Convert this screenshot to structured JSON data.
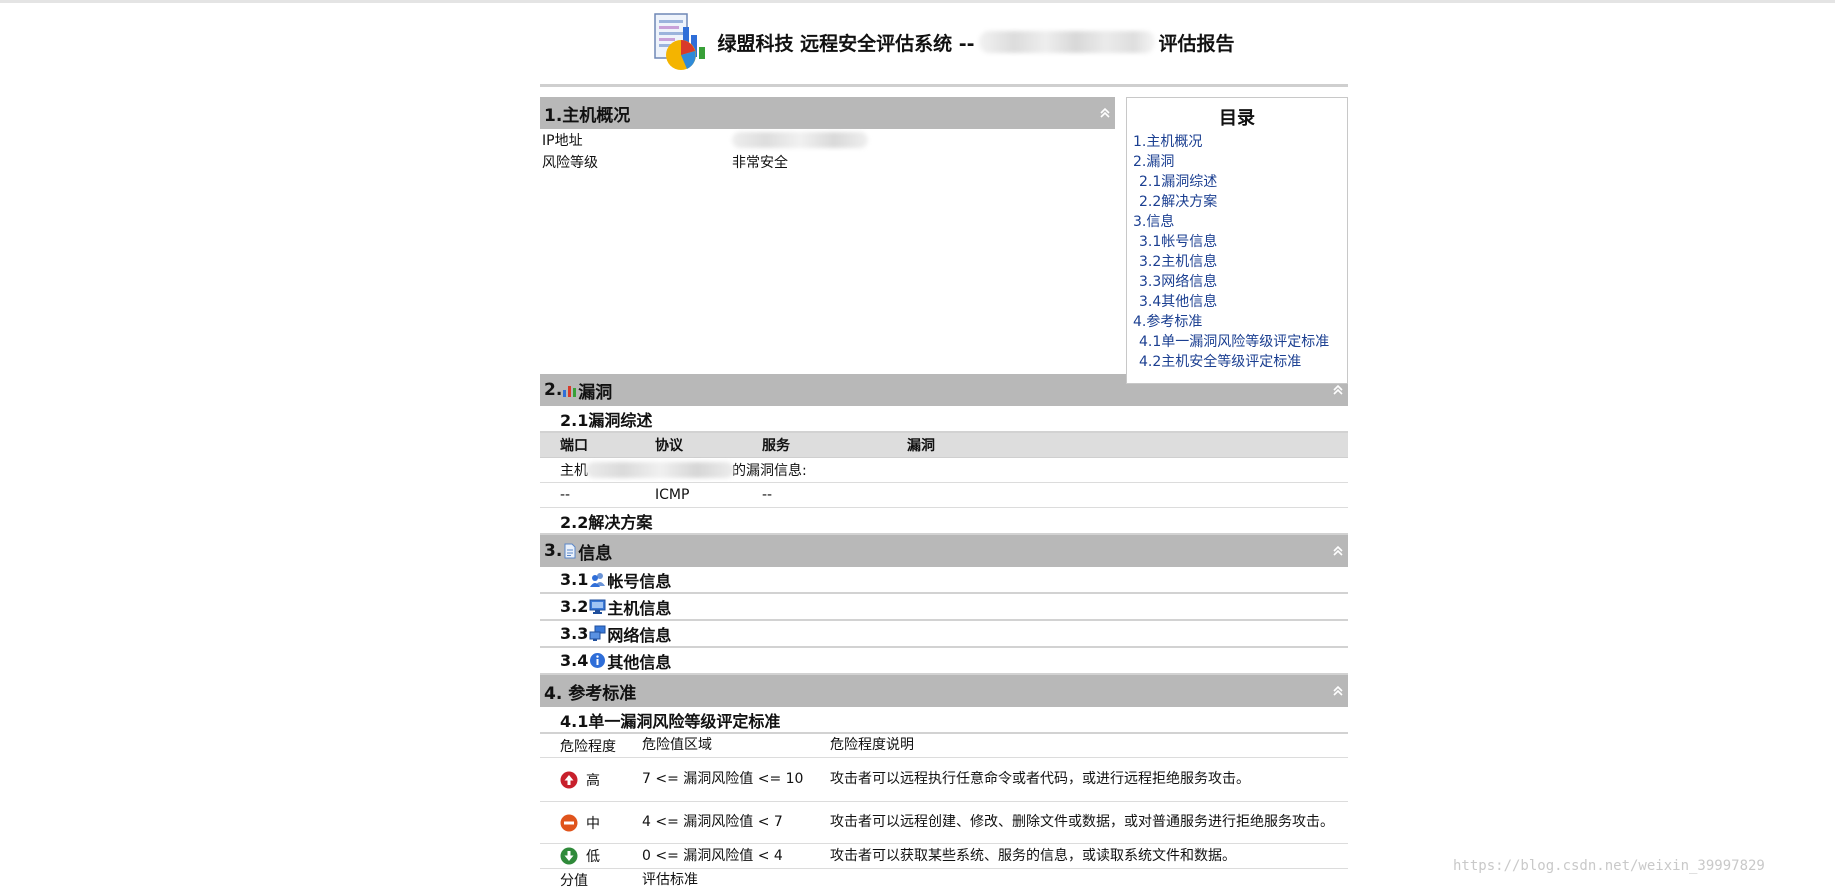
{
  "header": {
    "title_part1": "绿盟科技 远程安全评估系统 --",
    "title_part2": "评估报告",
    "logo_icon": "report-chart-icon"
  },
  "sec1": {
    "title": "1.主机概况",
    "rows": [
      {
        "label": "IP地址",
        "value": ""
      },
      {
        "label": "风险等级",
        "value": "非常安全"
      }
    ]
  },
  "toc": {
    "title": "目录",
    "items": [
      {
        "label": "1.主机概况",
        "sub": false
      },
      {
        "label": "2.漏洞",
        "sub": false
      },
      {
        "label": "2.1漏洞综述",
        "sub": true
      },
      {
        "label": "2.2解决方案",
        "sub": true
      },
      {
        "label": "3.信息",
        "sub": false
      },
      {
        "label": "3.1帐号信息",
        "sub": true
      },
      {
        "label": "3.2主机信息",
        "sub": true
      },
      {
        "label": "3.3网络信息",
        "sub": true
      },
      {
        "label": "3.4其他信息",
        "sub": true
      },
      {
        "label": "4.参考标准",
        "sub": false
      },
      {
        "label": "4.1单一漏洞风险等级评定标准",
        "sub": true
      },
      {
        "label": "4.2主机安全等级评定标准",
        "sub": true
      }
    ]
  },
  "sec2": {
    "num": "2.",
    "title": "漏洞",
    "sub1": "2.1漏洞综述",
    "sub2": "2.2解决方案",
    "columns": [
      "端口",
      "协议",
      "服务",
      "漏洞"
    ],
    "host_prefix": "主机",
    "host_suffix": "的漏洞信息:",
    "rows": [
      {
        "port": "--",
        "protocol": "ICMP",
        "service": "--",
        "vuln": ""
      }
    ]
  },
  "sec3": {
    "num": "3.",
    "title": "信息",
    "subs": [
      {
        "num": "3.1",
        "label": "帐号信息",
        "icon": "account-users-icon"
      },
      {
        "num": "3.2",
        "label": "主机信息",
        "icon": "host-monitor-icon"
      },
      {
        "num": "3.3",
        "label": "网络信息",
        "icon": "network-computers-icon"
      },
      {
        "num": "3.4",
        "label": "其他信息",
        "icon": "info-icon"
      }
    ]
  },
  "sec4": {
    "title": "4. 参考标准",
    "sub1": "4.1单一漏洞风险等级评定标准",
    "columns": [
      "危险程度",
      "危险值区域",
      "危险程度说明"
    ],
    "levels": [
      {
        "level": "高",
        "range": "7 <= 漏洞风险值 <= 10",
        "desc": "攻击者可以远程执行任意命令或者代码，或进行远程拒绝服务攻击。",
        "icon": "high-risk-icon",
        "color": "#c8202c"
      },
      {
        "level": "中",
        "range": "4 <= 漏洞风险值 < 7",
        "desc": "攻击者可以远程创建、修改、删除文件或数据，或对普通服务进行拒绝服务攻击。",
        "icon": "medium-risk-icon",
        "color": "#e0541c"
      },
      {
        "level": "低",
        "range": "0 <= 漏洞风险值 < 4",
        "desc": "攻击者可以获取某些系统、服务的信息，或读取系统文件和数据。",
        "icon": "low-risk-icon",
        "color": "#2f8a3a"
      }
    ],
    "footer_cols": [
      "分值",
      "评估标准"
    ]
  },
  "watermark": "https://blog.csdn.net/weixin_39997829"
}
